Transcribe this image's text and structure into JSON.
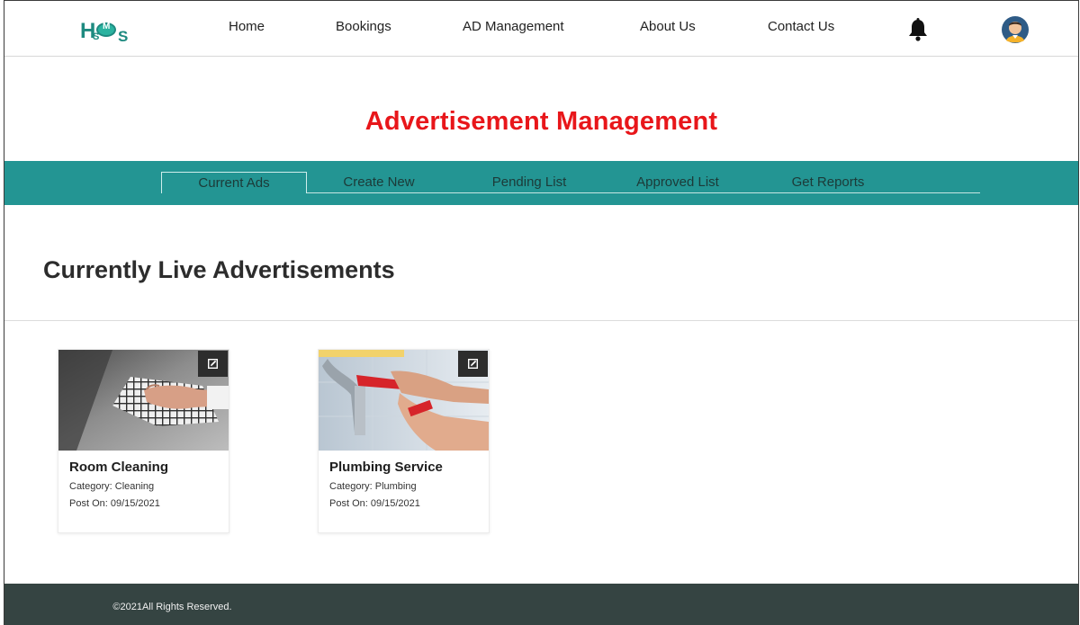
{
  "nav": {
    "logo_text": "HSMS",
    "links": [
      "Home",
      "Bookings",
      "AD Management",
      "About Us",
      "Contact Us"
    ]
  },
  "page_title": "Advertisement Management",
  "tabs": [
    "Current Ads",
    "Create New",
    "Pending List",
    "Approved List",
    "Get Reports"
  ],
  "active_tab": "Current Ads",
  "section_title": "Currently Live Advertisements",
  "cards": [
    {
      "name": "Room Cleaning",
      "category": "Category: Cleaning",
      "posted": "Post On: 09/15/2021",
      "image": "cleaning-photo"
    },
    {
      "name": "Plumbing Service",
      "category": "Category: Plumbing",
      "posted": "Post On: 09/15/2021",
      "image": "plumbing-photo"
    }
  ],
  "footer": {
    "text": "©2021All Rights Reserved."
  },
  "colors": {
    "accent_teal": "#239593",
    "title_red": "#e8161a",
    "footer_bg": "#354442"
  },
  "icons": [
    "bell-icon",
    "avatar-icon",
    "edit-icon"
  ]
}
